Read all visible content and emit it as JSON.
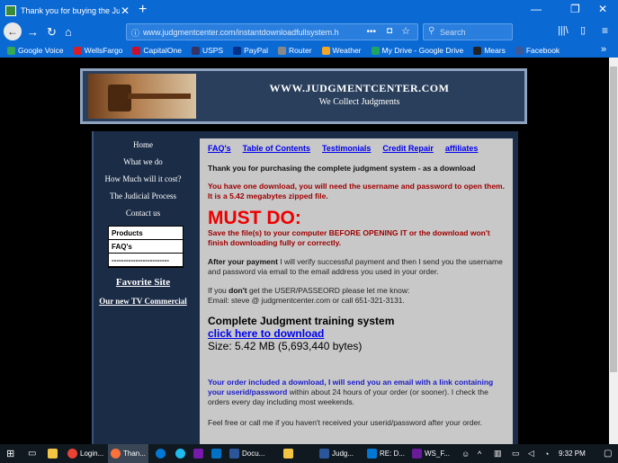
{
  "browser": {
    "tab_title": "Thank you for buying the Judg",
    "url": "www.judgmentcenter.com/instantdownloadfullsystem.h",
    "search_placeholder": "Search",
    "bookmarks": [
      {
        "label": "Google Voice",
        "color": "#34a853"
      },
      {
        "label": "WellsFargo",
        "color": "#d71e28"
      },
      {
        "label": "CapitalOne",
        "color": "#c8102e"
      },
      {
        "label": "USPS",
        "color": "#333366"
      },
      {
        "label": "PayPal",
        "color": "#003087"
      },
      {
        "label": "Router",
        "color": "#888888"
      },
      {
        "label": "Weather",
        "color": "#f5a623"
      },
      {
        "label": "My Drive - Google Drive",
        "color": "#1fa463"
      },
      {
        "label": "Mears",
        "color": "#222222"
      },
      {
        "label": "Facebook",
        "color": "#3b5998"
      }
    ]
  },
  "banner": {
    "site_name": "WWW.JUDGMENTCENTER.COM",
    "tagline": "We Collect Judgments"
  },
  "sidebar": {
    "links": [
      "Home",
      "What we do",
      "How Much will it cost?",
      "The Judicial Process",
      "Contact us"
    ],
    "box_items": [
      "Products",
      "FAQ's",
      "------------------------"
    ],
    "favorite_site": "Favorite Site",
    "tv_link": "Our new TV Commercial"
  },
  "content": {
    "top_links": [
      "FAQ's",
      "Table of Contents",
      "Testimonials",
      "Credit Repair",
      "affiliates"
    ],
    "thanks": "Thank you for purchasing the complete judgment system - as a download",
    "download_note": "You have one download, you will need the username and password to open them.  It is a 5.42 megabytes zipped file.",
    "must_do": "MUST DO:",
    "must_do_text": "Save the file(s) to your computer BEFORE OPENING IT or the download won't finish downloading fully or correctly.",
    "after_payment_bold": "After your payment",
    "after_payment_text": " I will verify successful payment and then I send you the username and password via email to the email address you used in your order.",
    "dont_get_pre": "If you ",
    "dont_get_bold": "don't",
    "dont_get_post": " get the USER/PASSEORD please let me know:",
    "email_line": "Email: steve @ judgmentcenter.com    or  call 651-321-3131.",
    "system_title": "Complete Judgment training system",
    "download_link": "click here to download",
    "size_text": "Size: 5.42 MB (5,693,440 bytes)",
    "order_blue": "Your order included a download, I will send you an email with a link containing your userid/password",
    "order_plain": " within about 24 hours of your order (or sooner). I check the orders every day including most weekends.",
    "feel_free": "Feel free or call me if you haven't received your userid/password after your order."
  },
  "taskbar": {
    "items": [
      {
        "label": "Login...",
        "color": "#ea4335"
      },
      {
        "label": "Than...",
        "color": "#ff7139"
      },
      {
        "label": "Docu...",
        "color": "#2b579a"
      },
      {
        "label": "Judg...",
        "color": "#2b579a"
      },
      {
        "label": "RE: D...",
        "color": "#0078d4"
      },
      {
        "label": "WS_F...",
        "color": "#6a1b9a"
      }
    ],
    "clock": "9:32 PM"
  }
}
